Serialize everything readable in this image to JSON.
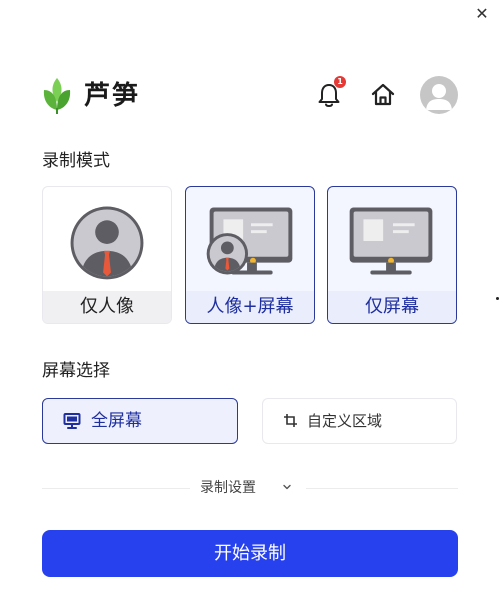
{
  "window": {
    "close_icon": "close-icon"
  },
  "header": {
    "app_name": "芦笋",
    "notification_count": "1",
    "icons": [
      "leaf-logo-icon",
      "bell-icon",
      "home-icon",
      "user-avatar-icon"
    ]
  },
  "recording_mode": {
    "title": "录制模式",
    "options": [
      {
        "label": "仅人像",
        "icon": "person-portrait-icon",
        "selected": false
      },
      {
        "label": "人像+屏幕",
        "icon": "monitor-with-person-icon",
        "selected": true
      },
      {
        "label": "仅屏幕",
        "icon": "monitor-icon",
        "selected": false
      }
    ]
  },
  "screen_select": {
    "title": "屏幕选择",
    "options": [
      {
        "label": "全屏幕",
        "icon": "desktop-icon",
        "selected": true
      },
      {
        "label": "自定义区域",
        "icon": "crop-icon",
        "selected": false
      }
    ]
  },
  "settings": {
    "label": "录制设置",
    "icon": "chevron-down-icon"
  },
  "start": {
    "label": "开始录制"
  },
  "colors": {
    "accent": "#2841ee",
    "selected_border": "#2b3a9a",
    "badge": "#e53935",
    "logo_green": "#6cc04a"
  }
}
